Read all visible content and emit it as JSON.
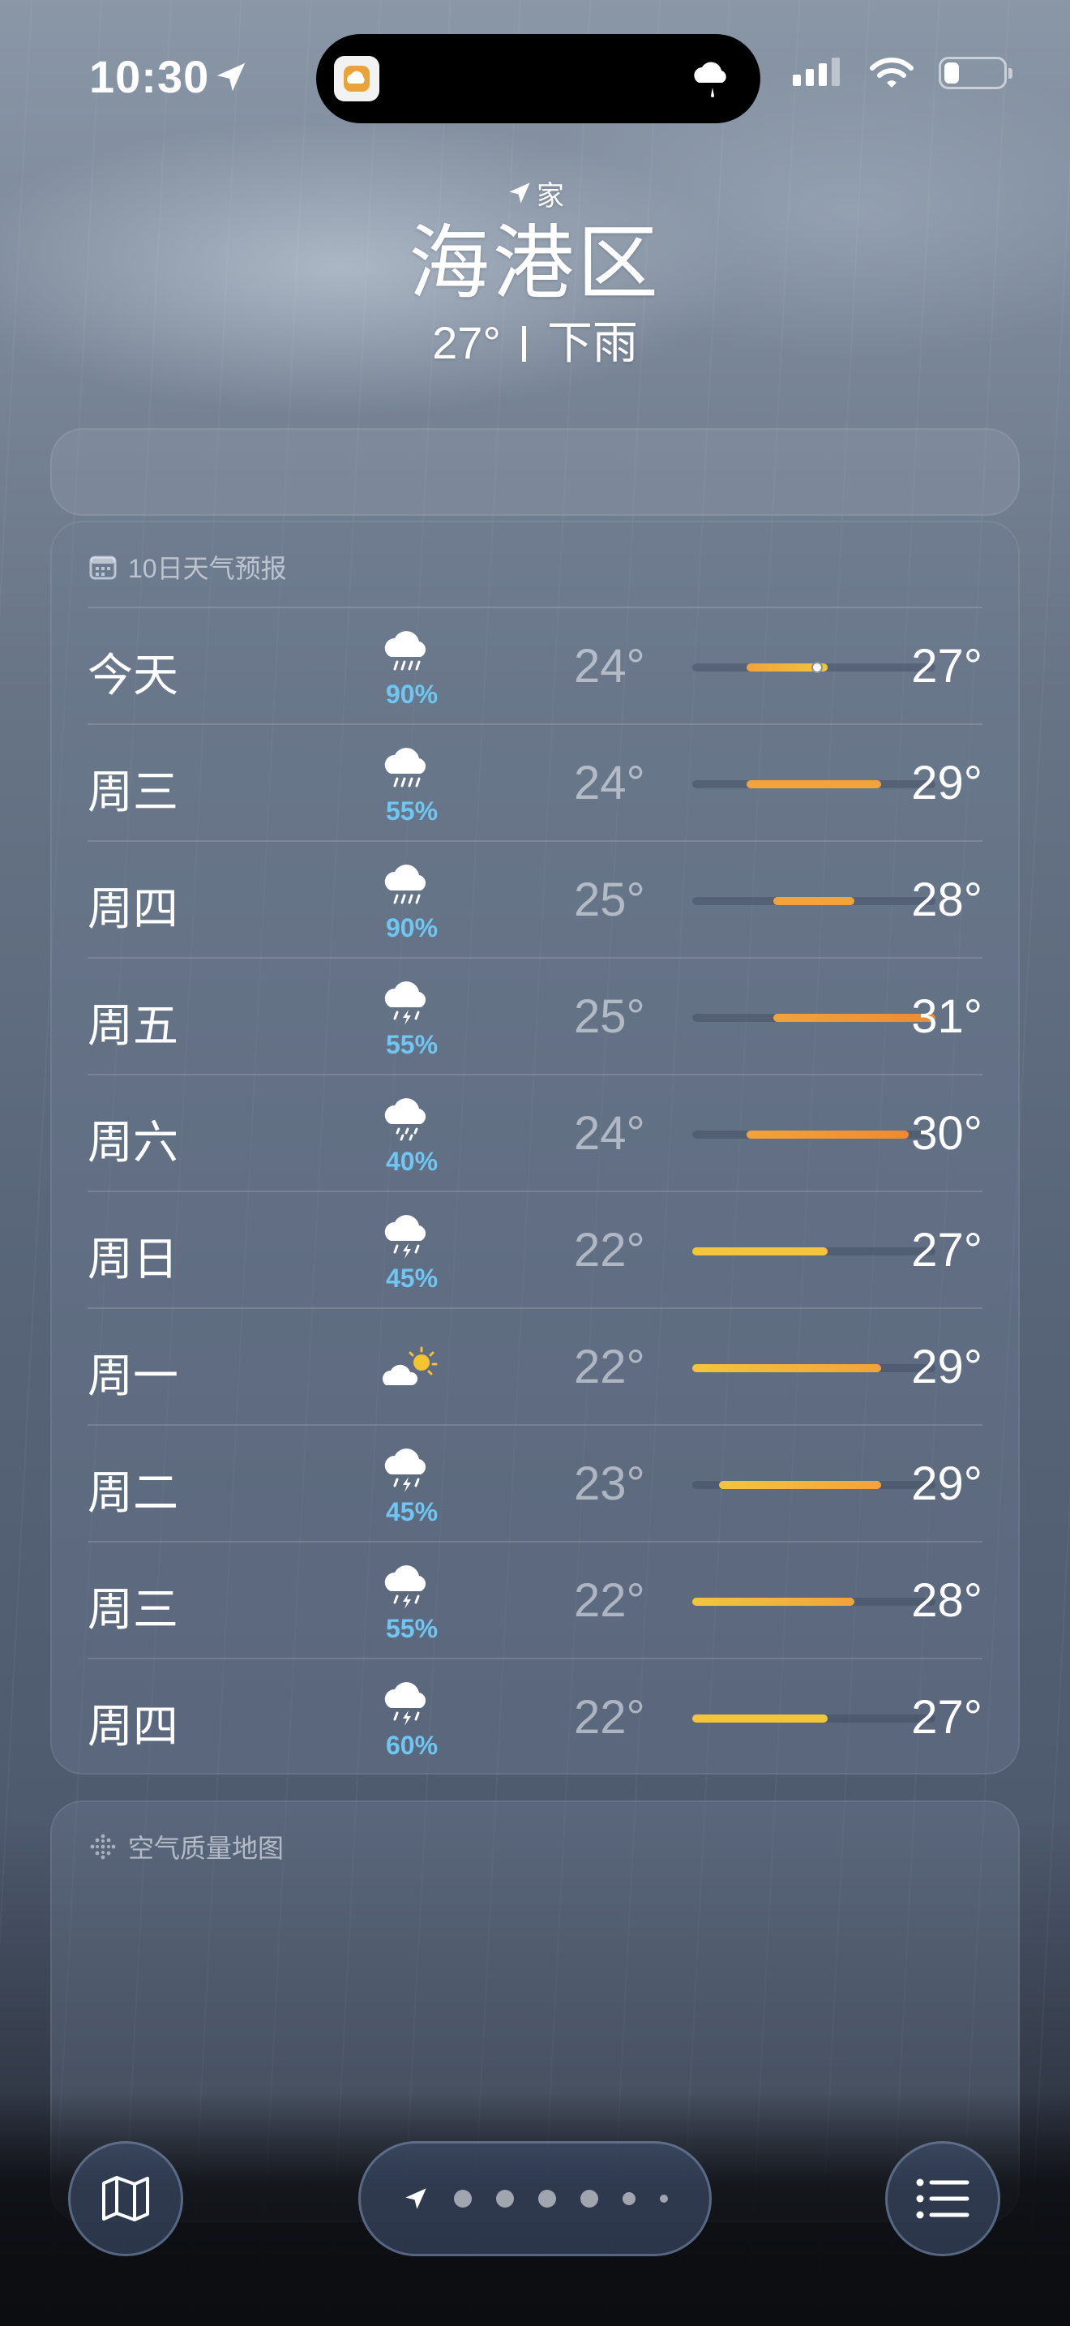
{
  "status_bar": {
    "time": "10:30",
    "signal_icon": "cellular-signal-icon",
    "wifi_icon": "wifi-icon",
    "battery_level": 0.25
  },
  "header": {
    "home_label": "家",
    "city": "海港区",
    "current_temp": "27°",
    "condition": "下雨"
  },
  "forecast": {
    "title": "10日天气预报",
    "title_icon": "calendar-icon",
    "range_min": 22,
    "range_max": 31,
    "current_temp_value": 27,
    "days": [
      {
        "day": "今天",
        "icon": "cloud-rain-icon",
        "pct": "90%",
        "low": "24°",
        "high": "27°",
        "low_v": 24,
        "high_v": 27
      },
      {
        "day": "周三",
        "icon": "cloud-rain-icon",
        "pct": "55%",
        "low": "24°",
        "high": "29°",
        "low_v": 24,
        "high_v": 29
      },
      {
        "day": "周四",
        "icon": "cloud-rain-icon",
        "pct": "90%",
        "low": "25°",
        "high": "28°",
        "low_v": 25,
        "high_v": 28
      },
      {
        "day": "周五",
        "icon": "cloud-bolt-rain-icon",
        "pct": "55%",
        "low": "25°",
        "high": "31°",
        "low_v": 25,
        "high_v": 31
      },
      {
        "day": "周六",
        "icon": "cloud-drizzle-icon",
        "pct": "40%",
        "low": "24°",
        "high": "30°",
        "low_v": 24,
        "high_v": 30
      },
      {
        "day": "周日",
        "icon": "cloud-bolt-rain-icon",
        "pct": "45%",
        "low": "22°",
        "high": "27°",
        "low_v": 22,
        "high_v": 27
      },
      {
        "day": "周一",
        "icon": "cloud-sun-icon",
        "pct": "",
        "low": "22°",
        "high": "29°",
        "low_v": 22,
        "high_v": 29
      },
      {
        "day": "周二",
        "icon": "cloud-bolt-rain-icon",
        "pct": "45%",
        "low": "23°",
        "high": "29°",
        "low_v": 23,
        "high_v": 29
      },
      {
        "day": "周三",
        "icon": "cloud-bolt-rain-icon",
        "pct": "55%",
        "low": "22°",
        "high": "28°",
        "low_v": 22,
        "high_v": 28
      },
      {
        "day": "周四",
        "icon": "cloud-bolt-rain-icon",
        "pct": "60%",
        "low": "22°",
        "high": "27°",
        "low_v": 22,
        "high_v": 27
      }
    ]
  },
  "air_quality": {
    "title": "空气质量地图",
    "title_icon": "air-quality-dots-icon"
  },
  "toolbar": {
    "map_icon": "map-icon",
    "location_icon": "location-arrow-icon",
    "list_icon": "list-icon",
    "page_count": 7
  }
}
